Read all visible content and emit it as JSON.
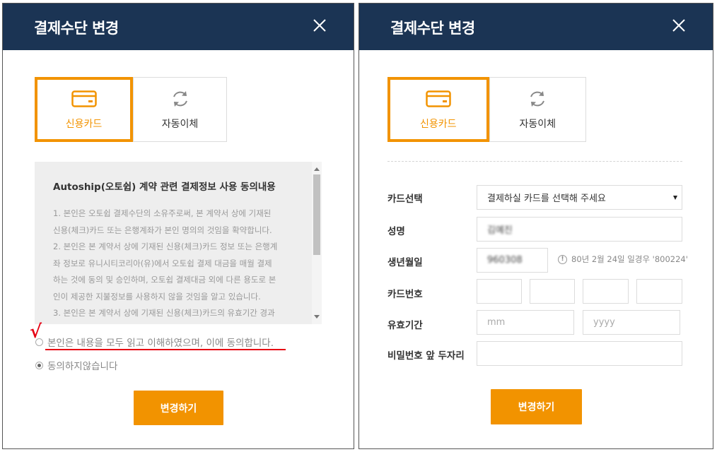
{
  "left_modal": {
    "title": "결제수단 변경",
    "tabs": [
      {
        "label": "신용카드",
        "icon": "credit-card-icon",
        "active": true
      },
      {
        "label": "자동이체",
        "icon": "refresh-icon",
        "active": false
      }
    ],
    "terms": {
      "title": "Autoship(오토쉽) 계약 관련 결제정보 사용 동의내용",
      "lines": [
        "1. 본인은 오토쉽 결제수단의 소유주로써, 본 계약서 상에 기재된",
        "신용(체크)카드 또는 은행계좌가 본인 명의의 것임을 확약합니다.",
        "2. 본인은 본 계약서 상에 기재된 신용(체크)카드 정보 또는 은행계",
        "좌 정보로 유니시티코리아(유)에서 오토쉽 결제 대금을 매월 결제",
        "하는 것에 동의 및 승인하며, 오토쉽 결제대금 외에 다른 용도로 본",
        "인이 제공한 지불정보를 사용하지 않을 것임을 알고 있습니다.",
        "3. 본인은 본 계약서 상에 기재된 신용(체크)카드의 유효기간 경과"
      ]
    },
    "agree_label": "본인은 내용을 모두 읽고 이해하였으며, 이에 동의합니다.",
    "disagree_label": "동의하지않습니다",
    "annotation_mark": "√",
    "submit_label": "변경하기"
  },
  "right_modal": {
    "title": "결제수단 변경",
    "tabs": [
      {
        "label": "신용카드",
        "icon": "credit-card-icon",
        "active": true
      },
      {
        "label": "자동이체",
        "icon": "refresh-icon",
        "active": false
      }
    ],
    "form": {
      "card_select_label": "카드선택",
      "card_select_value": "결제하실 카드를 선택해 주세요",
      "name_label": "성명",
      "name_value": "김예진",
      "birth_label": "생년월일",
      "birth_value": "960308",
      "birth_hint": "80년 2월 24일 일경우 '800224'",
      "card_number_label": "카드번호",
      "expiry_label": "유효기간",
      "expiry_month_placeholder": "mm",
      "expiry_year_placeholder": "yyyy",
      "password_label": "비밀번호 앞 두자리"
    },
    "submit_label": "변경하기"
  },
  "colors": {
    "header": "#1b3454",
    "accent": "#f29300",
    "annotation": "#e60012"
  }
}
